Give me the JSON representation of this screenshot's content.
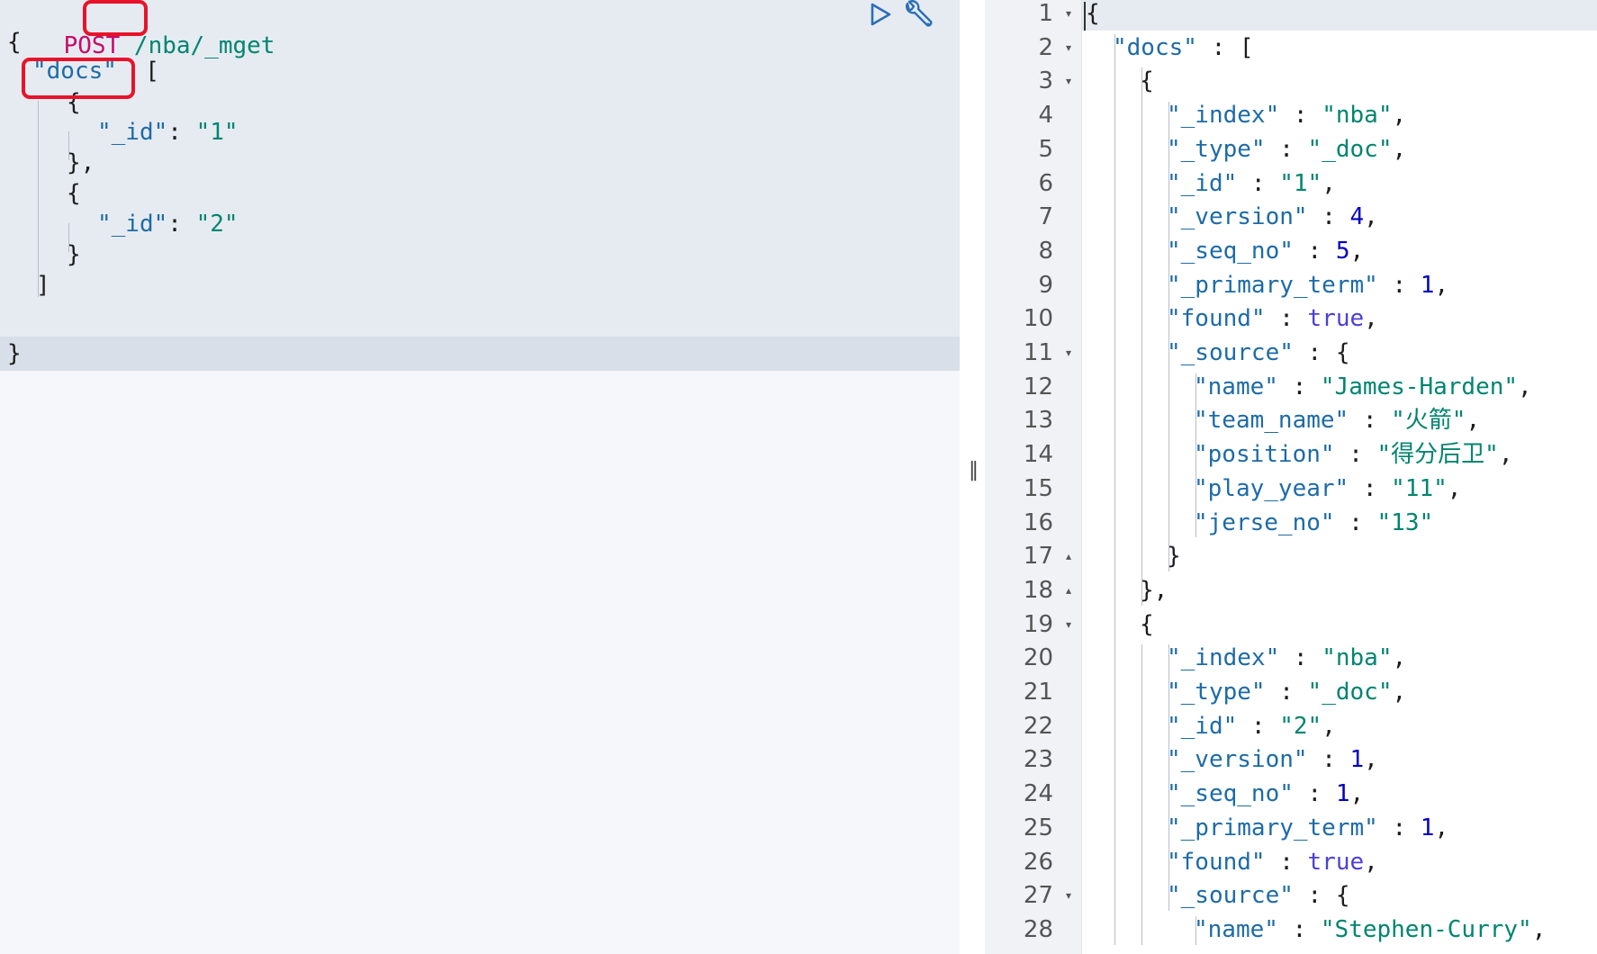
{
  "request": {
    "method": "POST",
    "url_slash": "/",
    "url_index": "nba",
    "url_rest": "/_mget",
    "lines": {
      "open_brace": "{",
      "docs_key": "\"docs\"",
      "docs_open": "[",
      "doc1_open": "{",
      "doc1_id_key": "\"_id\"",
      "doc1_id_colon": ": ",
      "doc1_id_val": "\"1\"",
      "doc1_close": "},",
      "doc2_open": "{",
      "doc2_id_key": "\"_id\"",
      "doc2_id_colon": ": ",
      "doc2_id_val": "\"2\"",
      "doc2_close": "}",
      "docs_close": "]",
      "close_brace": "}"
    }
  },
  "splitter": {
    "handle": "‖"
  },
  "response": {
    "line_numbers": [
      "1",
      "2",
      "3",
      "4",
      "5",
      "6",
      "7",
      "8",
      "9",
      "10",
      "11",
      "12",
      "13",
      "14",
      "15",
      "16",
      "17",
      "18",
      "19",
      "20",
      "21",
      "22",
      "23",
      "24",
      "25",
      "26",
      "27",
      "28"
    ],
    "fold_markers": {
      "1": "▾",
      "2": "▾",
      "3": "▾",
      "11": "▾",
      "17": "▴",
      "18": "▴",
      "19": "▾",
      "27": "▾"
    },
    "lines": [
      {
        "indent": 0,
        "parts": [
          [
            "brace",
            "{"
          ]
        ]
      },
      {
        "indent": 1,
        "parts": [
          [
            "key",
            "\"docs\""
          ],
          [
            "brace",
            " : ["
          ]
        ]
      },
      {
        "indent": 2,
        "parts": [
          [
            "brace",
            "{"
          ]
        ]
      },
      {
        "indent": 3,
        "parts": [
          [
            "key",
            "\"_index\""
          ],
          [
            "brace",
            " : "
          ],
          [
            "str",
            "\"nba\""
          ],
          [
            "brace",
            ","
          ]
        ]
      },
      {
        "indent": 3,
        "parts": [
          [
            "key",
            "\"_type\""
          ],
          [
            "brace",
            " : "
          ],
          [
            "str",
            "\"_doc\""
          ],
          [
            "brace",
            ","
          ]
        ]
      },
      {
        "indent": 3,
        "parts": [
          [
            "key",
            "\"_id\""
          ],
          [
            "brace",
            " : "
          ],
          [
            "str",
            "\"1\""
          ],
          [
            "brace",
            ","
          ]
        ]
      },
      {
        "indent": 3,
        "parts": [
          [
            "key",
            "\"_version\""
          ],
          [
            "brace",
            " : "
          ],
          [
            "num",
            "4"
          ],
          [
            "brace",
            ","
          ]
        ]
      },
      {
        "indent": 3,
        "parts": [
          [
            "key",
            "\"_seq_no\""
          ],
          [
            "brace",
            " : "
          ],
          [
            "num",
            "5"
          ],
          [
            "brace",
            ","
          ]
        ]
      },
      {
        "indent": 3,
        "parts": [
          [
            "key",
            "\"_primary_term\""
          ],
          [
            "brace",
            " : "
          ],
          [
            "num",
            "1"
          ],
          [
            "brace",
            ","
          ]
        ]
      },
      {
        "indent": 3,
        "parts": [
          [
            "key",
            "\"found\""
          ],
          [
            "brace",
            " : "
          ],
          [
            "bool",
            "true"
          ],
          [
            "brace",
            ","
          ]
        ]
      },
      {
        "indent": 3,
        "parts": [
          [
            "key",
            "\"_source\""
          ],
          [
            "brace",
            " : {"
          ]
        ]
      },
      {
        "indent": 4,
        "parts": [
          [
            "key",
            "\"name\""
          ],
          [
            "brace",
            " : "
          ],
          [
            "str",
            "\"James-Harden\""
          ],
          [
            "brace",
            ","
          ]
        ]
      },
      {
        "indent": 4,
        "parts": [
          [
            "key",
            "\"team_name\""
          ],
          [
            "brace",
            " : "
          ],
          [
            "str",
            "\"火箭\""
          ],
          [
            "brace",
            ","
          ]
        ]
      },
      {
        "indent": 4,
        "parts": [
          [
            "key",
            "\"position\""
          ],
          [
            "brace",
            " : "
          ],
          [
            "str",
            "\"得分后卫\""
          ],
          [
            "brace",
            ","
          ]
        ]
      },
      {
        "indent": 4,
        "parts": [
          [
            "key",
            "\"play_year\""
          ],
          [
            "brace",
            " : "
          ],
          [
            "str",
            "\"11\""
          ],
          [
            "brace",
            ","
          ]
        ]
      },
      {
        "indent": 4,
        "parts": [
          [
            "key",
            "\"jerse_no\""
          ],
          [
            "brace",
            " : "
          ],
          [
            "str",
            "\"13\""
          ]
        ]
      },
      {
        "indent": 3,
        "parts": [
          [
            "brace",
            "}"
          ]
        ]
      },
      {
        "indent": 2,
        "parts": [
          [
            "brace",
            "},"
          ]
        ]
      },
      {
        "indent": 2,
        "parts": [
          [
            "brace",
            "{"
          ]
        ]
      },
      {
        "indent": 3,
        "parts": [
          [
            "key",
            "\"_index\""
          ],
          [
            "brace",
            " : "
          ],
          [
            "str",
            "\"nba\""
          ],
          [
            "brace",
            ","
          ]
        ]
      },
      {
        "indent": 3,
        "parts": [
          [
            "key",
            "\"_type\""
          ],
          [
            "brace",
            " : "
          ],
          [
            "str",
            "\"_doc\""
          ],
          [
            "brace",
            ","
          ]
        ]
      },
      {
        "indent": 3,
        "parts": [
          [
            "key",
            "\"_id\""
          ],
          [
            "brace",
            " : "
          ],
          [
            "str",
            "\"2\""
          ],
          [
            "brace",
            ","
          ]
        ]
      },
      {
        "indent": 3,
        "parts": [
          [
            "key",
            "\"_version\""
          ],
          [
            "brace",
            " : "
          ],
          [
            "num",
            "1"
          ],
          [
            "brace",
            ","
          ]
        ]
      },
      {
        "indent": 3,
        "parts": [
          [
            "key",
            "\"_seq_no\""
          ],
          [
            "brace",
            " : "
          ],
          [
            "num",
            "1"
          ],
          [
            "brace",
            ","
          ]
        ]
      },
      {
        "indent": 3,
        "parts": [
          [
            "key",
            "\"_primary_term\""
          ],
          [
            "brace",
            " : "
          ],
          [
            "num",
            "1"
          ],
          [
            "brace",
            ","
          ]
        ]
      },
      {
        "indent": 3,
        "parts": [
          [
            "key",
            "\"found\""
          ],
          [
            "brace",
            " : "
          ],
          [
            "bool",
            "true"
          ],
          [
            "brace",
            ","
          ]
        ]
      },
      {
        "indent": 3,
        "parts": [
          [
            "key",
            "\"_source\""
          ],
          [
            "brace",
            " : {"
          ]
        ]
      },
      {
        "indent": 4,
        "parts": [
          [
            "key",
            "\"name\""
          ],
          [
            "brace",
            " : "
          ],
          [
            "str",
            "\"Stephen-Curry\""
          ],
          [
            "brace",
            ","
          ]
        ]
      }
    ]
  },
  "icons": {
    "run": "play-icon",
    "settings": "wrench-icon"
  },
  "colors": {
    "method": "#c80a68",
    "string": "#00856f",
    "key": "#1d6ba7",
    "number": "#0000c0",
    "boolean": "#4b3fd6",
    "highlight_box": "#e8132a"
  }
}
